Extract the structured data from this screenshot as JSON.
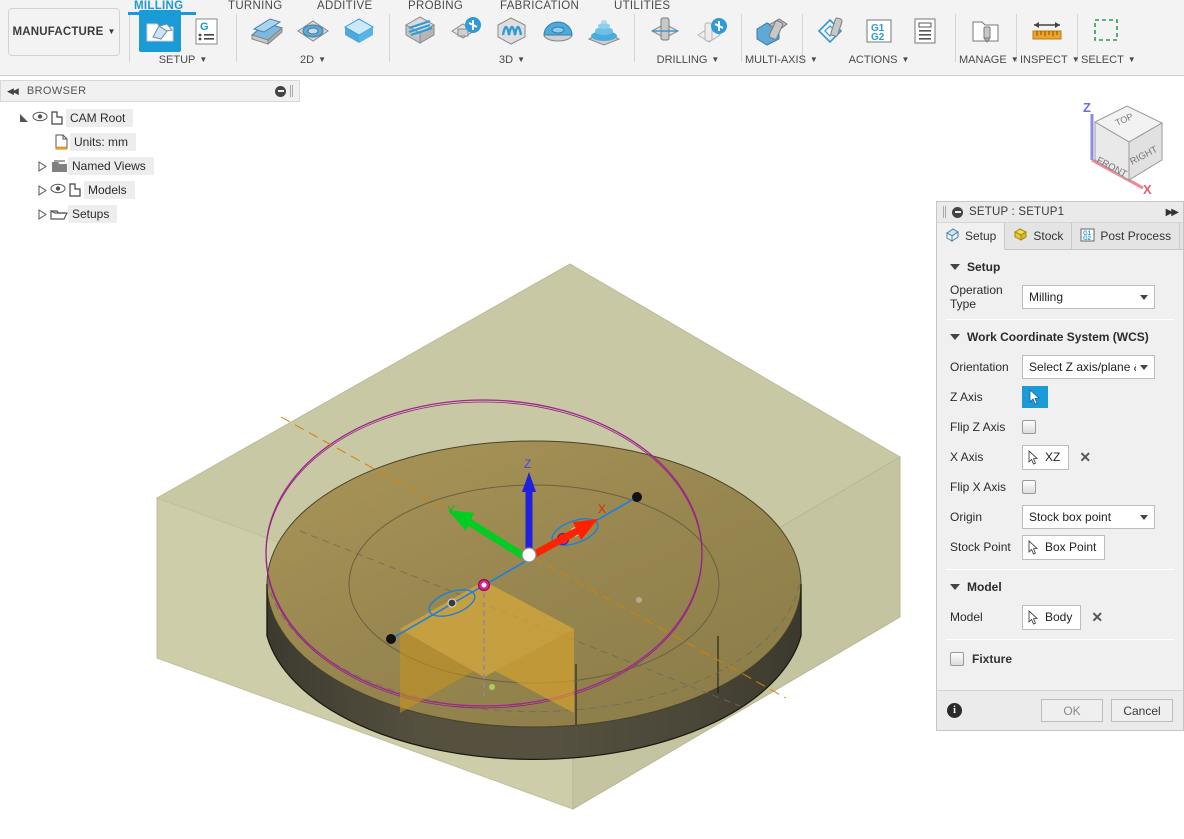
{
  "ribbon": {
    "workspace": {
      "label": "MANUFACTURE",
      "caret": "chevron-down-icon"
    },
    "tabs": [
      {
        "label": "MILLING",
        "active": true
      },
      {
        "label": "TURNING",
        "active": false
      },
      {
        "label": "ADDITIVE",
        "active": false
      },
      {
        "label": "PROBING",
        "active": false
      },
      {
        "label": "FABRICATION",
        "active": false
      },
      {
        "label": "UTILITIES",
        "active": false
      }
    ],
    "groups": [
      {
        "name": "SETUP",
        "icons": [
          "setup-folder-icon",
          "g-code-list-icon"
        ]
      },
      {
        "name": "2D",
        "icons": [
          "face-icon",
          "adaptive-2d-icon",
          "pocket-2d-icon"
        ]
      },
      {
        "name": "3D",
        "icons": [
          "adaptive-3d-icon",
          "pocket-clearing-icon",
          "parallel-3d-icon",
          "scallop-icon",
          "spiral-3d-icon"
        ]
      },
      {
        "name": "DRILLING",
        "icons": [
          "drill-icon",
          "bore-icon"
        ]
      },
      {
        "name": "MULTI-AXIS",
        "icons": [
          "multi-axis-icon"
        ]
      },
      {
        "name": "ACTIONS",
        "icons": [
          "simulate-icon",
          "post-process-icon",
          "setup-sheet-icon"
        ]
      },
      {
        "name": "MANAGE",
        "icons": [
          "tool-library-icon"
        ]
      },
      {
        "name": "INSPECT",
        "icons": [
          "measure-icon"
        ]
      },
      {
        "name": "SELECT",
        "icons": [
          "select-window-icon"
        ]
      }
    ]
  },
  "browser": {
    "title": "BROWSER",
    "collapse_icon": "collapse-left-icon",
    "minimize_icon": "minus-circle-icon",
    "tree": [
      {
        "label": "CAM Root",
        "expander": "expanded",
        "eye": true,
        "icon": "body-icon",
        "indent": 0
      },
      {
        "label": "Units: mm",
        "expander": "none",
        "eye": false,
        "icon": "document-mm-icon",
        "indent": 1
      },
      {
        "label": "Named Views",
        "expander": "collapsed",
        "eye": false,
        "icon": "folder-icon",
        "indent": 1
      },
      {
        "label": "Models",
        "expander": "collapsed",
        "eye": true,
        "icon": "body-icon",
        "indent": 1
      },
      {
        "label": "Setups",
        "expander": "collapsed",
        "eye": false,
        "icon": "open-folder-icon",
        "indent": 1
      }
    ]
  },
  "viewcube": {
    "faces": {
      "top": "TOP",
      "front": "FRONT",
      "right": "RIGHT"
    },
    "axes": {
      "z": "Z",
      "x": "X"
    }
  },
  "viewport": {
    "triad": {
      "z": "Z",
      "y": "Y",
      "x": "X"
    },
    "colors": {
      "stock": "#c9c9a6",
      "model_top": "#96864f",
      "model_side": "#4e4a3c",
      "sketch": "#a0258f",
      "axis_x": "#ff2200",
      "axis_y": "#00cc22",
      "axis_z": "#2020dd",
      "origin_marker": "#ffffff",
      "construction": "#d98000",
      "selection_blue": "#1a7fe0"
    }
  },
  "setup_dialog": {
    "title": "SETUP : SETUP1",
    "title_icon": "minus-circle-icon",
    "expand_icon": "chevron-double-right-icon",
    "tabs": [
      {
        "label": "Setup",
        "icon": "setup-tab-icon",
        "active": true
      },
      {
        "label": "Stock",
        "icon": "stock-cube-icon",
        "active": false
      },
      {
        "label": "Post Process",
        "icon": "post-process-g1g2-icon",
        "active": false
      }
    ],
    "sections": {
      "setup": {
        "heading": "Setup",
        "operation_type": {
          "label": "Operation Type",
          "value": "Milling"
        }
      },
      "wcs": {
        "heading": "Work Coordinate System (WCS)",
        "orientation": {
          "label": "Orientation",
          "value": "Select Z axis/plane & ..."
        },
        "z_axis": {
          "label": "Z Axis",
          "value": "",
          "icon": "cursor-select-icon",
          "selected": true
        },
        "flip_z_axis": {
          "label": "Flip Z Axis",
          "checked": false
        },
        "x_axis": {
          "label": "X Axis",
          "value": "XZ",
          "icon": "cursor-select-icon",
          "clear_icon": "x-clear-icon"
        },
        "flip_x_axis": {
          "label": "Flip X Axis",
          "checked": false
        },
        "origin": {
          "label": "Origin",
          "value": "Stock box point"
        },
        "stock_point": {
          "label": "Stock Point",
          "value": "Box Point",
          "icon": "cursor-select-icon"
        }
      },
      "model": {
        "heading": "Model",
        "model": {
          "label": "Model",
          "value": "Body",
          "icon": "cursor-select-icon",
          "clear_icon": "x-clear-icon"
        }
      },
      "fixture": {
        "label": "Fixture",
        "checked": false
      }
    },
    "footer": {
      "info_icon": "info-icon",
      "ok_label": "OK",
      "cancel_label": "Cancel"
    }
  }
}
